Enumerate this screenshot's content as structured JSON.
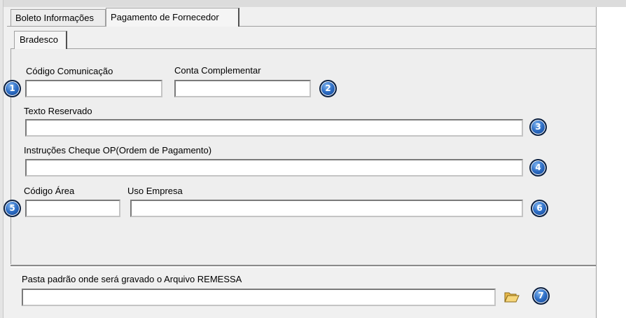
{
  "tabs": {
    "outer": [
      {
        "label": "Boleto Informações"
      },
      {
        "label": "Pagamento de Fornecedor"
      }
    ],
    "inner": {
      "label": "Bradesco"
    }
  },
  "form": {
    "codigo_comunicacao": {
      "label": "Código Comunicação",
      "value": ""
    },
    "conta_complementar": {
      "label": "Conta Complementar",
      "value": ""
    },
    "texto_reservado": {
      "label": "Texto Reservado",
      "value": ""
    },
    "instrucoes_cheque": {
      "label": "Instruções Cheque OP(Ordem de Pagamento)",
      "value": ""
    },
    "codigo_area": {
      "label": "Código Área",
      "value": ""
    },
    "uso_empresa": {
      "label": "Uso Empresa",
      "value": ""
    },
    "pasta_remessa": {
      "label": "Pasta padrão onde será gravado o Arquivo REMESSA",
      "value": ""
    }
  },
  "badges": [
    "1",
    "2",
    "3",
    "4",
    "5",
    "6",
    "7"
  ],
  "icons": {
    "browse": "folder-open-icon"
  },
  "colors": {
    "badge_fill": "#2f6fc6",
    "badge_border": "#0b1f3f",
    "panel_bg": "#eeeeee"
  }
}
